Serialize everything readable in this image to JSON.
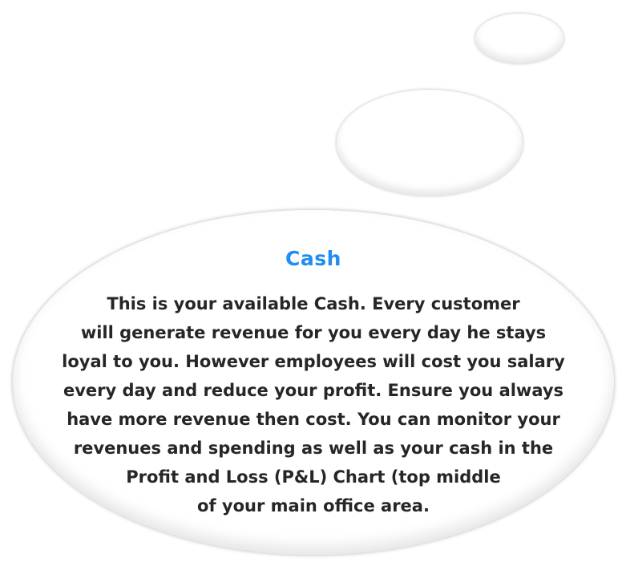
{
  "tooltip": {
    "title": "Cash",
    "body_lines": [
      "This is your available Cash. Every customer",
      "will generate revenue for you every day he stays",
      "loyal to you. However employees will cost you salary",
      "every day and reduce your profit. Ensure you always",
      "have more revenue then cost. You can monitor your",
      "revenues and spending as well as your cash in the",
      "Profit and Loss (P&L) Chart (top middle",
      "of your main office area."
    ]
  },
  "colors": {
    "title": "#1f8ef0",
    "body_text": "#262626",
    "bubble_fill": "#ffffff",
    "background": "#ffffff"
  }
}
